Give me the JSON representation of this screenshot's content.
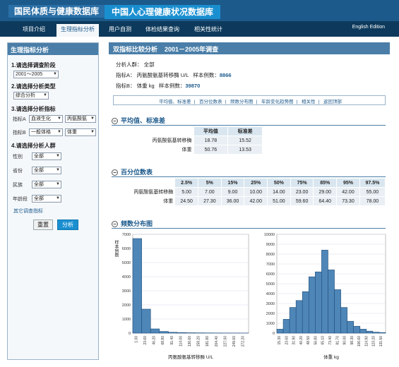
{
  "banner": {
    "title1": "国民体质与健康数据库",
    "title2": "中国人心理健康状况数据库"
  },
  "nav": {
    "items": [
      "项目介绍",
      "生理指标分析",
      "用户自测",
      "体检结果查询",
      "相关性统计"
    ],
    "active_index": 1,
    "english": "English Edition"
  },
  "sidebar": {
    "title": "生理指标分析",
    "s1": "1.请选择调查阶段",
    "stage": "2001～2005",
    "s2": "2.请选择分析类型",
    "type": "综合分析",
    "s3": "3.请选择分析指标",
    "labA": "指标A",
    "a1": "血液生化",
    "a2": "丙氨酸氨",
    "labB": "指标B",
    "b1": "一般体格",
    "b2": "体重",
    "s4": "4.请选择分析人群",
    "fields": [
      {
        "label": "性别",
        "value": "全部"
      },
      {
        "label": "省份",
        "value": "全部"
      },
      {
        "label": "民族",
        "value": "全部"
      },
      {
        "label": "年龄段",
        "value": "全部"
      }
    ],
    "link": "其它调查指标",
    "reset": "重置",
    "analyze": "分析"
  },
  "main": {
    "header": "双指标比较分析",
    "header_period": "2001－2005年调查",
    "crowd_label": "分析人群：",
    "crowd_value": "全部",
    "a_label": "指标A：",
    "a_name": "丙氨酸氨基转移酶 U/L",
    "a_sample_label": "样本例数：",
    "a_sample": "8866",
    "b_label": "指标B：",
    "b_name": "体重 kg",
    "b_sample_label": "样本例数：",
    "b_sample": "39870",
    "links": [
      "平均值、标准差",
      "百分位数表",
      "频数分布图",
      "年龄变化趋势图",
      "相关性",
      "返回顶部"
    ]
  },
  "mean_sd": {
    "title": "平均值、标准差",
    "headers": [
      "",
      "平均值",
      "标准差"
    ],
    "rows": [
      [
        "丙氨酸氨基转移酶",
        "18.78",
        "15.52"
      ],
      [
        "体重",
        "50.76",
        "13.53"
      ]
    ]
  },
  "percentile": {
    "title": "百分位数表",
    "headers": [
      "",
      "2.5%",
      "5%",
      "15%",
      "25%",
      "50%",
      "75%",
      "85%",
      "95%",
      "97.5%"
    ],
    "rows": [
      [
        "丙氨酸氨基转移酶",
        "5.00",
        "7.00",
        "9.00",
        "10.00",
        "14.00",
        "23.00",
        "29.00",
        "42.00",
        "55.00"
      ],
      [
        "体重",
        "24.50",
        "27.30",
        "36.00",
        "42.00",
        "51.00",
        "59.60",
        "64.40",
        "73.30",
        "78.00"
      ]
    ]
  },
  "freq": {
    "title": "频数分布图",
    "ylabel": "样本例数"
  },
  "chart_data": [
    {
      "type": "bar",
      "ylabel": "样本例数",
      "xlabel": "丙氨酸氨基转移酶 U/L",
      "ylim": [
        0,
        7000
      ],
      "yticks": [
        0,
        1000,
        2000,
        3000,
        4000,
        5000,
        6000,
        7000
      ],
      "xticks": [
        "1.00",
        "23.60",
        "46.20",
        "68.80",
        "91.40",
        "114.00",
        "136.60",
        "159.20",
        "181.80",
        "204.40",
        "227.00",
        "249.60",
        "272.20"
      ],
      "values": [
        6700,
        1700,
        300,
        120,
        60,
        40,
        25,
        20,
        15,
        12,
        10,
        8,
        6
      ],
      "grid": true
    },
    {
      "type": "bar",
      "xlabel": "体重 kg",
      "ylim": [
        0,
        10000
      ],
      "yticks": [
        0,
        1000,
        2000,
        3000,
        4000,
        5000,
        6000,
        7000,
        8000,
        9000,
        10000
      ],
      "xticks": [
        "15.30",
        "23.60",
        "31.90",
        "40.20",
        "48.50",
        "56.80",
        "65.10",
        "73.40",
        "81.70",
        "90.00",
        "98.30",
        "106.60",
        "114.90",
        "123.20",
        "131.50"
      ],
      "values": [
        400,
        1400,
        2600,
        3300,
        4200,
        5700,
        6200,
        8400,
        6400,
        4400,
        2600,
        1200,
        700,
        400,
        200,
        100,
        60
      ],
      "grid": true
    }
  ]
}
